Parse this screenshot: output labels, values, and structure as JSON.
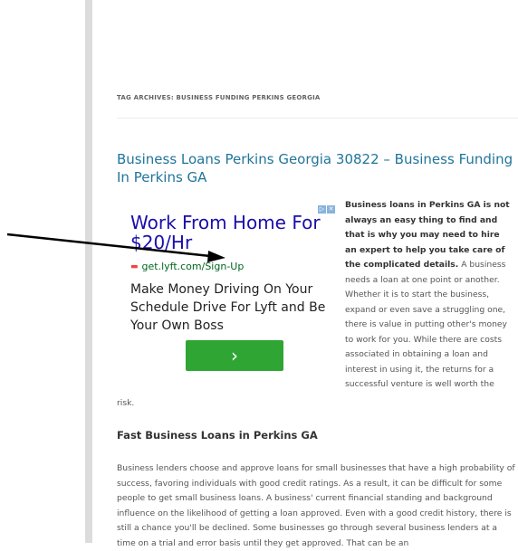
{
  "archive": {
    "label": "TAG ARCHIVES: BUSINESS FUNDING PERKINS GEORGIA"
  },
  "post": {
    "title": "Business Loans Perkins Georgia 30822 – Business Funding In Perkins GA",
    "intro_bold": "Business loans in Perkins GA is not always an easy thing to find and that is why you may need to hire an expert to help you take care of the complicated details.",
    "intro_rest": " A business needs a loan at one point or another. Whether it is to start the business, expand or even save a struggling one, there is value in putting other's money to work for you. While there are costs associated in obtaining a loan and interest in using it, the returns for a successful venture is well worth the",
    "intro_tail": "risk.",
    "section_heading": "Fast Business Loans in Perkins GA",
    "body": "Business lenders choose and approve loans for small businesses that have a high probability of success, favoring individuals with good credit ratings. As a result, it can be difficult for some people to get small business loans. A business' current financial standing and background influence on the likelihood of getting a loan approved. Even with a good credit history, there is still a chance you'll be declined. Some businesses go through several business lenders at a time on a trial and error basis until they get approved. That can be an"
  },
  "ad": {
    "title": "Work From Home For $20/Hr",
    "link": "get.lyft.com/Sign-Up",
    "description": "Make Money Driving On Your Schedule Drive For Lyft and Be Your Own Boss",
    "button_glyph": "›",
    "choices_icons": [
      "▷",
      "✕"
    ]
  },
  "colors": {
    "title_link": "#21759b",
    "ad_title": "#1a0dab",
    "ad_url": "#006621",
    "button": "#2fa534",
    "sidebar": "#dcdcdc"
  },
  "icons": {
    "ad_link_icon": "link-icon",
    "arrow_annotation": "arrow-icon"
  }
}
